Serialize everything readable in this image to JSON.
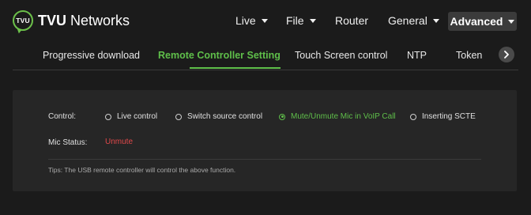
{
  "brand": {
    "logo_badge": "TVU",
    "name_bold": "TVU",
    "name_rest": " Networks",
    "accent_color": "#5fbf4a"
  },
  "nav": {
    "items": [
      {
        "label": "Live",
        "dropdown": true
      },
      {
        "label": "File",
        "dropdown": true
      },
      {
        "label": "Router",
        "dropdown": false
      },
      {
        "label": "General",
        "dropdown": true
      },
      {
        "label": "Advanced",
        "dropdown": true,
        "active": true
      }
    ]
  },
  "tabs": {
    "items": [
      {
        "label": "Progressive download"
      },
      {
        "label": "Remote Controller Setting",
        "active": true
      },
      {
        "label": "Touch Screen control"
      },
      {
        "label": "NTP"
      },
      {
        "label": "Token"
      }
    ],
    "next_icon": "chevron-right-icon"
  },
  "settings": {
    "control_label": "Control:",
    "control_options": [
      {
        "label": "Live control",
        "selected": false
      },
      {
        "label": "Switch source control",
        "selected": false
      },
      {
        "label": "Mute/Unmute Mic in VoIP Call",
        "selected": true
      },
      {
        "label": "Inserting SCTE",
        "selected": false
      }
    ],
    "mic_status_label": "Mic Status:",
    "mic_status_value": "Unmute",
    "mic_status_color": "#e0484a",
    "tips": "Tips: The USB remote controller will control the above function."
  }
}
